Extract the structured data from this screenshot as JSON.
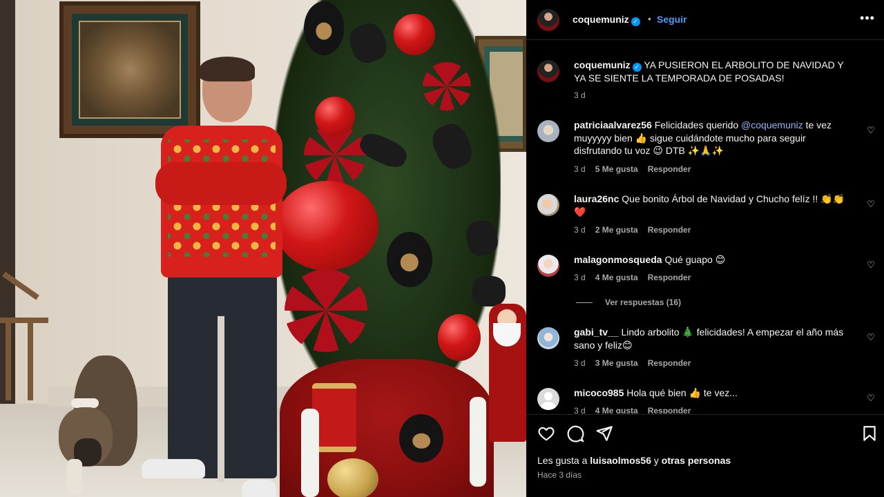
{
  "post": {
    "owner": "coquemuniz",
    "follow_label": "Seguir",
    "dot": "•",
    "more": "•••",
    "caption": "YA PUSIERON EL ARBOLITO DE NAVIDAD Y YA SE SIENTE LA TEMPORADA DE POSADAS!",
    "caption_time": "3 d",
    "verified_mark": "✓"
  },
  "comments": [
    {
      "user": "patriciaalvarez56",
      "text_before": "Felicidades querido ",
      "mention": "@coquemuniz",
      "text_after": " te vez muyyyyy bien 👍 sigue cuidándote mucho para seguir disfrutando tu voz 😉 DTB ✨🙏✨",
      "time": "3 d",
      "likes": "5 Me gusta",
      "reply": "Responder"
    },
    {
      "user": "laura26nc",
      "text": "Que bonito Árbol de Navidad y Chucho felíz !! 👏👏❤️",
      "time": "3 d",
      "likes": "2 Me gusta",
      "reply": "Responder"
    },
    {
      "user": "malagonmosqueda",
      "text": "Qué guapo 😊",
      "time": "3 d",
      "likes": "4 Me gusta",
      "reply": "Responder",
      "view_replies": "Ver respuestas (16)"
    },
    {
      "user": "gabi_tv__",
      "text": "Lindo arbolito 🎄 felicidades! A empezar el año más sano y feliz😊",
      "time": "3 d",
      "likes": "3 Me gusta",
      "reply": "Responder"
    },
    {
      "user": "micoco985",
      "text": "Hola qué bien 👍 te vez...",
      "time": "3 d",
      "likes": "4 Me gusta",
      "reply": "Responder"
    }
  ],
  "footer": {
    "likes_prefix": "Les gusta a ",
    "likes_user": "luisaolmos56",
    "likes_mid": " y ",
    "likes_rest": "otras personas",
    "posted_ago": "Hace 3 días"
  },
  "icons": {
    "heart": "heart-icon",
    "comment": "comment-icon",
    "share": "share-icon",
    "save": "bookmark-icon"
  },
  "colors": {
    "link_blue": "#4a9df7",
    "verified_blue": "#0095f6",
    "background": "#000000",
    "muted": "#a8a8a8"
  }
}
